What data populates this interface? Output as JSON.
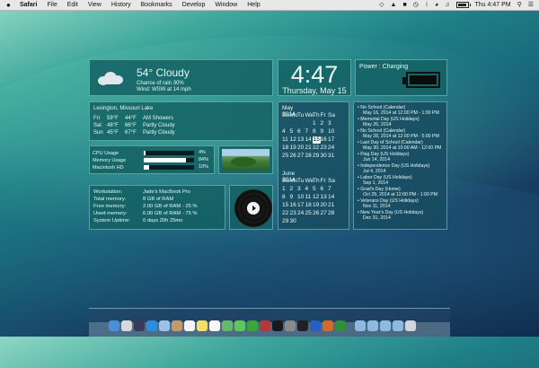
{
  "menubar": {
    "apple": "",
    "items": [
      "Safari",
      "File",
      "Edit",
      "View",
      "History",
      "Bookmarks",
      "Develop",
      "Window",
      "Help"
    ],
    "clock": "Thu 4:47 PM"
  },
  "weather": {
    "temp": "54° Cloudy",
    "line1": "Chance of rain 30%",
    "line2": "Wind: WSW at 14 mph"
  },
  "clock": {
    "time": "4:47",
    "date": "Thursday, May 15"
  },
  "power": {
    "label": "Power : Charging",
    "level": 1.0
  },
  "forecast": {
    "location": "Lexington, Missouri Lake",
    "rows": [
      {
        "day": "Fri",
        "hi": "59°F",
        "lo": "44°F",
        "cond": "AM Showers"
      },
      {
        "day": "Sat",
        "hi": "48°F",
        "lo": "66°F",
        "cond": "Partly Cloudy"
      },
      {
        "day": "Sun",
        "hi": "45°F",
        "lo": "67°F",
        "cond": "Partly Cloudy"
      }
    ]
  },
  "cpu": {
    "rows": [
      {
        "label": "CPU Usage",
        "value": 0.04,
        "pct": "4%"
      },
      {
        "label": "Memory Usage",
        "value": 0.84,
        "pct": "84%"
      },
      {
        "label": "Macintosh HD",
        "value": 0.1,
        "pct": "10%"
      }
    ]
  },
  "system": {
    "rows": [
      {
        "k": "Workstation:",
        "v": "Jade's MacBook Pro"
      },
      {
        "k": "Total memory:",
        "v": "8 GB of RAM"
      },
      {
        "k": "Free memory:",
        "v": "2.00 GB of RAM - 25 %"
      },
      {
        "k": "Used memory:",
        "v": "6.00 GB of RAM - 75 %"
      },
      {
        "k": "System Uptime:",
        "v": "0 days 20h 25mn"
      }
    ]
  },
  "calendar": {
    "months": [
      {
        "title": "May 2014",
        "header": [
          "Su",
          "Mo",
          "Tu",
          "We",
          "Th",
          "Fr",
          "Sa"
        ],
        "cells": [
          "",
          "",
          "",
          "",
          "1",
          "2",
          "3",
          "4",
          "5",
          "6",
          "7",
          "8",
          "9",
          "10",
          "11",
          "12",
          "13",
          "14",
          "15",
          "16",
          "17",
          "18",
          "19",
          "20",
          "21",
          "22",
          "23",
          "24",
          "25",
          "26",
          "27",
          "28",
          "29",
          "30",
          "31"
        ],
        "today": "15"
      },
      {
        "title": "June 2014",
        "header": [
          "Su",
          "Mo",
          "Tu",
          "We",
          "Th",
          "Fr",
          "Sa"
        ],
        "cells": [
          "1",
          "2",
          "3",
          "4",
          "5",
          "6",
          "7",
          "8",
          "9",
          "10",
          "11",
          "12",
          "13",
          "14",
          "15",
          "16",
          "17",
          "18",
          "19",
          "20",
          "21",
          "22",
          "23",
          "24",
          "25",
          "26",
          "27",
          "28",
          "29",
          "30"
        ],
        "today": ""
      }
    ]
  },
  "events": [
    {
      "t": "• No School (Calendar)",
      "d": "May 16, 2014 at 12:00 PM - 1:00 PM"
    },
    {
      "t": "• Memorial Day (US Holidays)",
      "d": "May 26, 2014"
    },
    {
      "t": "• No School (Calendar)",
      "d": "May 28, 2014 at 12:00 PM - 5:00 PM"
    },
    {
      "t": "• Last Day of School (Calendar)",
      "d": "May 30, 2014 at 10:00 AM - 12:00 PM"
    },
    {
      "t": "• Flag Day (US Holidays)",
      "d": "Jun 14, 2014"
    },
    {
      "t": "• Independence Day (US Holidays)",
      "d": "Jul 4, 2014"
    },
    {
      "t": "• Labor Day (US Holidays)",
      "d": "Sep 1, 2014"
    },
    {
      "t": "• Grad's Day (Home)",
      "d": "Oct 25, 2014 at 12:00 PM - 1:00 PM"
    },
    {
      "t": "• Veterans Day (US Holidays)",
      "d": "Nov 11, 2014"
    },
    {
      "t": "• New Year's Day (US Holidays)",
      "d": "Dec 31, 2014"
    }
  ],
  "dock": {
    "icons": [
      {
        "name": "finder-icon",
        "color": "#4a90d9"
      },
      {
        "name": "launchpad-icon",
        "color": "#d9d9d9"
      },
      {
        "name": "mission-control-icon",
        "color": "#3a3a5a"
      },
      {
        "name": "safari-icon",
        "color": "#2d8be0"
      },
      {
        "name": "mail-icon",
        "color": "#9cc3e6"
      },
      {
        "name": "contacts-icon",
        "color": "#c49a6c"
      },
      {
        "name": "calendar-icon",
        "color": "#f4f4f4"
      },
      {
        "name": "notes-icon",
        "color": "#f5df6a"
      },
      {
        "name": "reminders-icon",
        "color": "#f7f7f7"
      },
      {
        "name": "maps-icon",
        "color": "#68b86b"
      },
      {
        "name": "messages-icon",
        "color": "#5ec85c"
      },
      {
        "name": "facetime-icon",
        "color": "#3aa63a"
      },
      {
        "name": "photo-booth-icon",
        "color": "#b23a3a"
      },
      {
        "name": "spotify-icon",
        "color": "#1a1a1a"
      },
      {
        "name": "system-preferences-icon",
        "color": "#8a8a8a"
      },
      {
        "name": "terminal-icon",
        "color": "#202020"
      },
      {
        "name": "word-icon",
        "color": "#2b5fbf"
      },
      {
        "name": "powerpoint-icon",
        "color": "#d26a2c"
      },
      {
        "name": "excel-icon",
        "color": "#2f8f3a"
      },
      {
        "name": "folder-icon",
        "color": "#8fb9e0"
      },
      {
        "name": "folder-2-icon",
        "color": "#8fb9e0"
      },
      {
        "name": "downloads-icon",
        "color": "#8fb9e0"
      },
      {
        "name": "documents-icon",
        "color": "#8fb9e0"
      },
      {
        "name": "trash-icon",
        "color": "#d0d6dc"
      }
    ]
  }
}
